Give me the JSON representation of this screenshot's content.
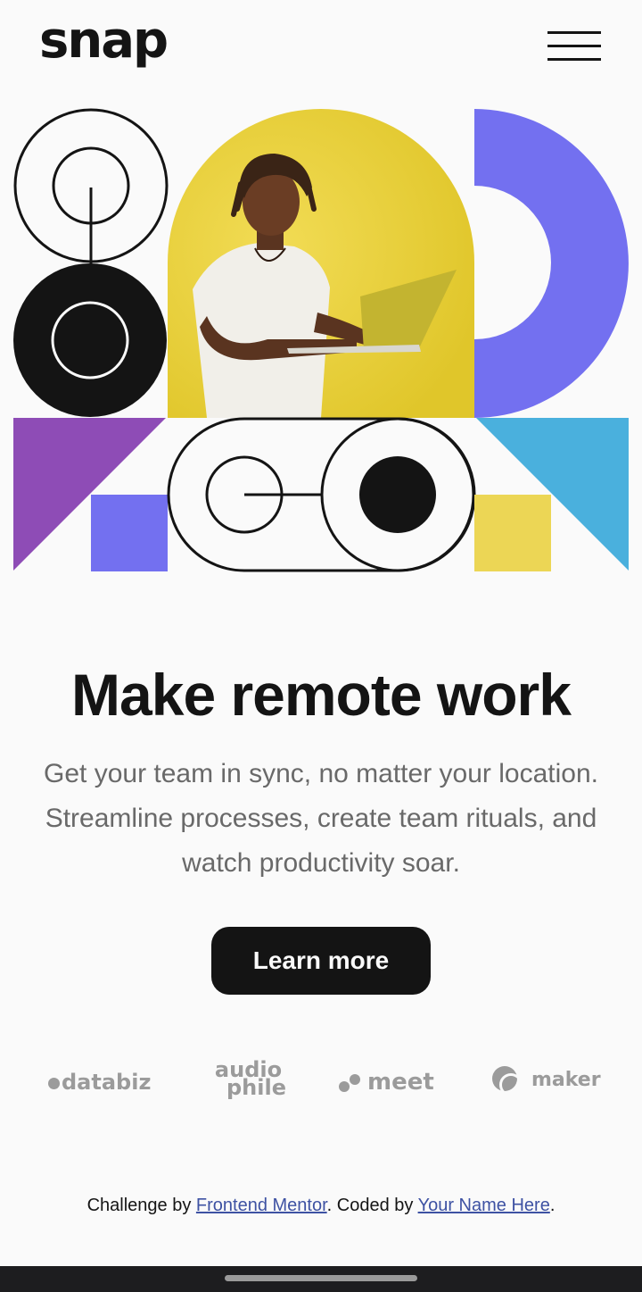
{
  "header": {
    "logo": "snap",
    "menu_icon": "hamburger-menu-icon"
  },
  "hero": {
    "illustration": "geometric-shapes-with-person-using-laptop",
    "colors": {
      "yellow": "#e6cb2f",
      "purple": "#7370f0",
      "violet": "#8e4cb6",
      "blue": "#4ab0dd",
      "pale_yellow": "#ecd655",
      "black": "#141414"
    }
  },
  "main": {
    "headline": "Make remote work",
    "subtext": "Get your team in sync, no matter your location. Streamline processes, create team rituals, and watch productivity soar.",
    "cta_label": "Learn more"
  },
  "clients": [
    {
      "name": "databiz",
      "icon": "databiz-logo"
    },
    {
      "name_top": "audio",
      "name_bottom": "phile",
      "icon": "audiophile-logo"
    },
    {
      "name": "meet",
      "icon": "meet-logo"
    },
    {
      "name": "maker",
      "icon": "maker-logo"
    }
  ],
  "footer": {
    "prefix": "Challenge by ",
    "link1": "Frontend Mentor",
    "middle": ". Coded by ",
    "link2": "Your Name Here",
    "suffix": "."
  },
  "colors": {
    "background": "#fafafa",
    "text": "#141414",
    "muted": "#696969",
    "link": "#3e52a3"
  }
}
